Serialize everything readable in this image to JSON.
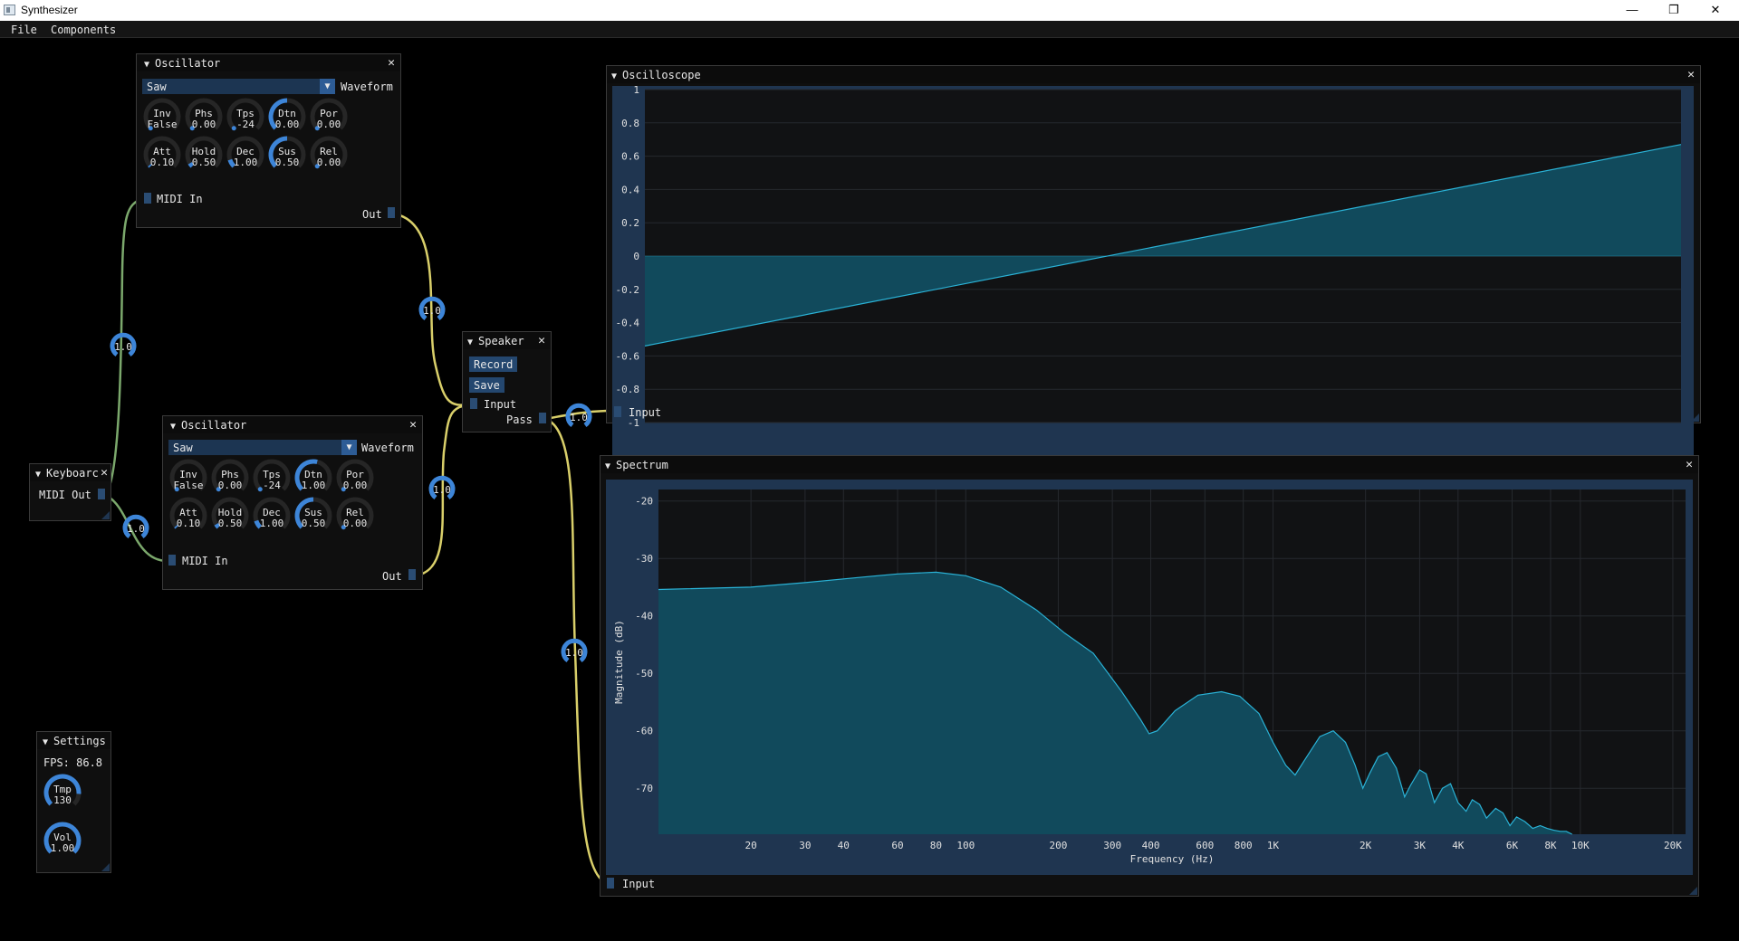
{
  "window": {
    "title": "Synthesizer",
    "minimize": "—",
    "maximize": "❐",
    "close": "✕"
  },
  "menu": {
    "items": [
      "File",
      "Components"
    ]
  },
  "osc1": {
    "title": "Oscillator",
    "waveform_value": "Saw",
    "waveform_label": "Waveform",
    "knobs": [
      {
        "name": "Inv",
        "value": "False",
        "fill": 0
      },
      {
        "name": "Phs",
        "value": "0.00",
        "fill": 0
      },
      {
        "name": "Tps",
        "value": "-24",
        "fill": 0
      },
      {
        "name": "Dtn",
        "value": "0.00",
        "fill": 0.5
      },
      {
        "name": "Por",
        "value": "0.00",
        "fill": 0
      },
      {
        "name": "Att",
        "value": "0.10",
        "fill": 0.02
      },
      {
        "name": "Hold",
        "value": "0.50",
        "fill": 0.05
      },
      {
        "name": "Dec",
        "value": "1.00",
        "fill": 0.1
      },
      {
        "name": "Sus",
        "value": "0.50",
        "fill": 0.5
      },
      {
        "name": "Rel",
        "value": "0.00",
        "fill": 0
      }
    ],
    "midi_in": "MIDI In",
    "out": "Out"
  },
  "osc2": {
    "title": "Oscillator",
    "waveform_value": "Saw",
    "waveform_label": "Waveform",
    "knobs": [
      {
        "name": "Inv",
        "value": "False",
        "fill": 0
      },
      {
        "name": "Phs",
        "value": "0.00",
        "fill": 0
      },
      {
        "name": "Tps",
        "value": "-24",
        "fill": 0
      },
      {
        "name": "Dtn",
        "value": "1.00",
        "fill": 0.55
      },
      {
        "name": "Por",
        "value": "0.00",
        "fill": 0
      },
      {
        "name": "Att",
        "value": "0.10",
        "fill": 0.02
      },
      {
        "name": "Hold",
        "value": "0.50",
        "fill": 0.05
      },
      {
        "name": "Dec",
        "value": "1.00",
        "fill": 0.1
      },
      {
        "name": "Sus",
        "value": "0.50",
        "fill": 0.5
      },
      {
        "name": "Rel",
        "value": "0.00",
        "fill": 0
      }
    ],
    "midi_in": "MIDI In",
    "out": "Out"
  },
  "keyboard": {
    "title": "Keyboarc",
    "midi_out": "MIDI Out"
  },
  "speaker": {
    "title": "Speaker",
    "record": "Record",
    "save": "Save",
    "input": "Input",
    "pass": "Pass"
  },
  "settings": {
    "title": "Settings",
    "fps": "FPS: 86.8",
    "knobs": [
      {
        "name": "Tmp",
        "value": "130",
        "fill": 0.85
      },
      {
        "name": "Vol",
        "value": "1.00",
        "fill": 1.0
      }
    ]
  },
  "wire_gain_label": "1.0",
  "oscilloscope": {
    "title": "Oscilloscope",
    "input": "Input"
  },
  "spectrum": {
    "title": "Spectrum",
    "input": "Input"
  },
  "colors": {
    "accent": "#3d85d8",
    "fill": "#114a5c",
    "line": "#2ab2d6",
    "wire_yellow": "#d9cf6a",
    "wire_green": "#7ba86c"
  },
  "chart_data": [
    {
      "type": "area",
      "series": [
        {
          "x": [
            0,
            1
          ],
          "values": [
            -0.54,
            0.67
          ]
        }
      ],
      "baseline": 0,
      "ylim": [
        -1,
        1
      ],
      "yticks": [
        "1",
        "0.8",
        "0.6",
        "0.4",
        "0.2",
        "0",
        "-0.2",
        "-0.4",
        "-0.6",
        "-0.8",
        "-1"
      ],
      "grid": true
    },
    {
      "type": "area",
      "xscale": "log",
      "ylabel": "Magnitude (dB)",
      "xlabel": "Frequency (Hz)",
      "ylim": [
        -78,
        -18
      ],
      "yticks": [
        "-20",
        "-30",
        "-40",
        "-50",
        "-60",
        "-70"
      ],
      "xticks": [
        {
          "v": 20,
          "label": "20"
        },
        {
          "v": 30,
          "label": "30"
        },
        {
          "v": 40,
          "label": "40"
        },
        {
          "v": 60,
          "label": "60"
        },
        {
          "v": 80,
          "label": "80"
        },
        {
          "v": 100,
          "label": "100"
        },
        {
          "v": 200,
          "label": "200"
        },
        {
          "v": 300,
          "label": "300"
        },
        {
          "v": 400,
          "label": "400"
        },
        {
          "v": 600,
          "label": "600"
        },
        {
          "v": 800,
          "label": "800"
        },
        {
          "v": 1000,
          "label": "1K"
        },
        {
          "v": 2000,
          "label": "2K"
        },
        {
          "v": 3000,
          "label": "3K"
        },
        {
          "v": 4000,
          "label": "4K"
        },
        {
          "v": 6000,
          "label": "6K"
        },
        {
          "v": 8000,
          "label": "8K"
        },
        {
          "v": 10000,
          "label": "10K"
        },
        {
          "v": 20000,
          "label": "20K"
        }
      ],
      "series": [
        {
          "points": [
            [
              10,
              -35.4
            ],
            [
              20,
              -35.0
            ],
            [
              30,
              -34.2
            ],
            [
              45,
              -33.3
            ],
            [
              60,
              -32.7
            ],
            [
              80,
              -32.4
            ],
            [
              100,
              -33.0
            ],
            [
              130,
              -35.0
            ],
            [
              170,
              -39.0
            ],
            [
              210,
              -43.0
            ],
            [
              260,
              -46.5
            ],
            [
              320,
              -53.0
            ],
            [
              370,
              -58.0
            ],
            [
              395,
              -60.5
            ],
            [
              420,
              -60.0
            ],
            [
              480,
              -56.5
            ],
            [
              570,
              -53.8
            ],
            [
              680,
              -53.2
            ],
            [
              780,
              -54.0
            ],
            [
              900,
              -57.0
            ],
            [
              1000,
              -62.0
            ],
            [
              1100,
              -66.0
            ],
            [
              1180,
              -67.7
            ],
            [
              1270,
              -65.0
            ],
            [
              1420,
              -61.0
            ],
            [
              1570,
              -60.0
            ],
            [
              1720,
              -62.0
            ],
            [
              1850,
              -66.0
            ],
            [
              1960,
              -70.0
            ],
            [
              2060,
              -67.5
            ],
            [
              2200,
              -64.5
            ],
            [
              2350,
              -63.8
            ],
            [
              2520,
              -66.5
            ],
            [
              2680,
              -71.5
            ],
            [
              2800,
              -69.5
            ],
            [
              3000,
              -66.8
            ],
            [
              3150,
              -67.5
            ],
            [
              3350,
              -72.5
            ],
            [
              3560,
              -70.0
            ],
            [
              3780,
              -69.2
            ],
            [
              4000,
              -72.5
            ],
            [
              4250,
              -74.0
            ],
            [
              4450,
              -72.0
            ],
            [
              4700,
              -72.8
            ],
            [
              4950,
              -75.2
            ],
            [
              5300,
              -73.5
            ],
            [
              5600,
              -74.3
            ],
            [
              5900,
              -76.5
            ],
            [
              6200,
              -75.0
            ],
            [
              6600,
              -75.8
            ],
            [
              7000,
              -77.0
            ],
            [
              7400,
              -76.5
            ],
            [
              7800,
              -77.0
            ],
            [
              8200,
              -77.3
            ],
            [
              8600,
              -77.5
            ],
            [
              9000,
              -77.5
            ],
            [
              9400,
              -78.0
            ]
          ]
        }
      ],
      "grid": true
    }
  ]
}
